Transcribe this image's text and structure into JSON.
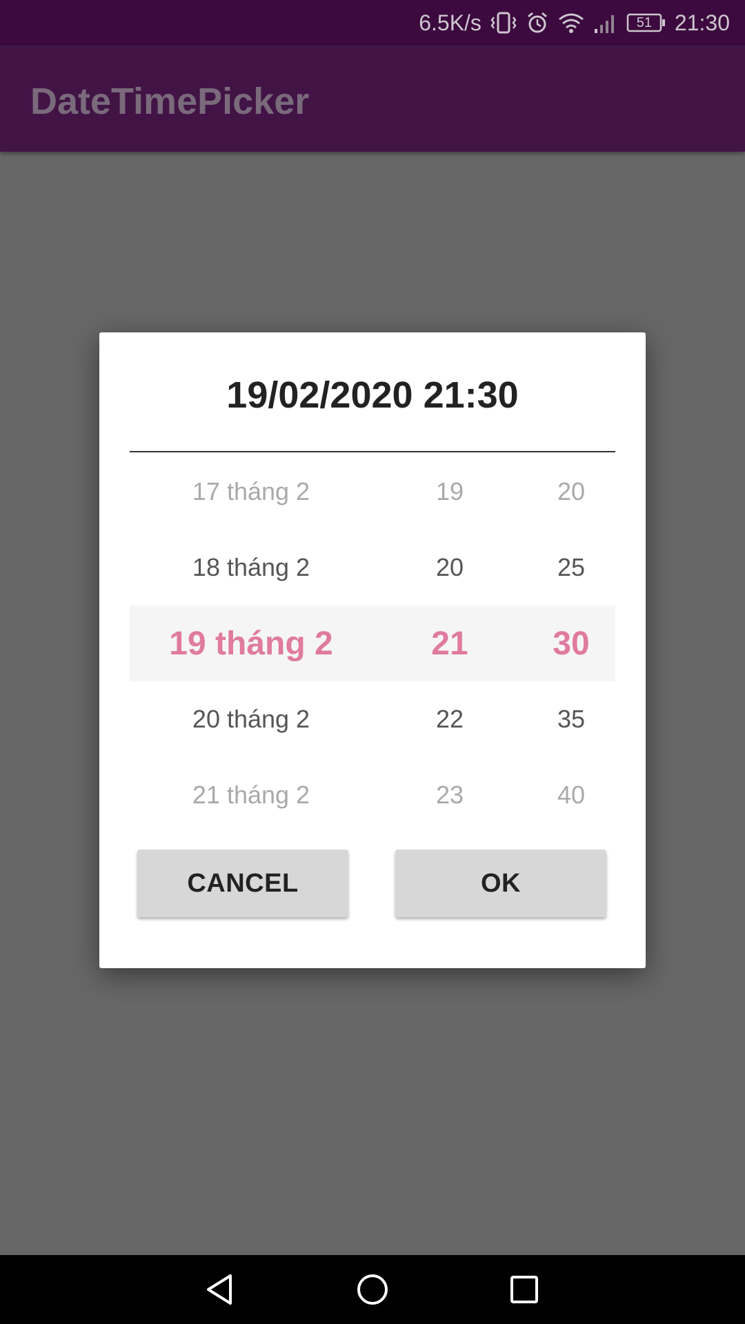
{
  "status_bar": {
    "net_speed": "6.5K/s",
    "battery": "51",
    "time": "21:30",
    "icons": [
      "vibrate-icon",
      "alarm-icon",
      "wifi-icon",
      "signal-icon",
      "battery-icon"
    ]
  },
  "app_bar": {
    "title": "DateTimePicker"
  },
  "dialog": {
    "title": "19/02/2020 21:30",
    "date_column": [
      "17 tháng 2",
      "18 tháng 2",
      "19 tháng 2",
      "20 tháng 2",
      "21 tháng 2"
    ],
    "hour_column": [
      "19",
      "20",
      "21",
      "22",
      "23"
    ],
    "minute_column": [
      "20",
      "25",
      "30",
      "35",
      "40"
    ],
    "selected": {
      "date": "19 tháng 2",
      "hour": "21",
      "minute": "30"
    },
    "cancel_label": "CANCEL",
    "ok_label": "OK",
    "accent_color": "#e07a9f"
  },
  "nav_bar": {
    "icons": [
      "back-icon",
      "home-icon",
      "recent-apps-icon"
    ]
  }
}
